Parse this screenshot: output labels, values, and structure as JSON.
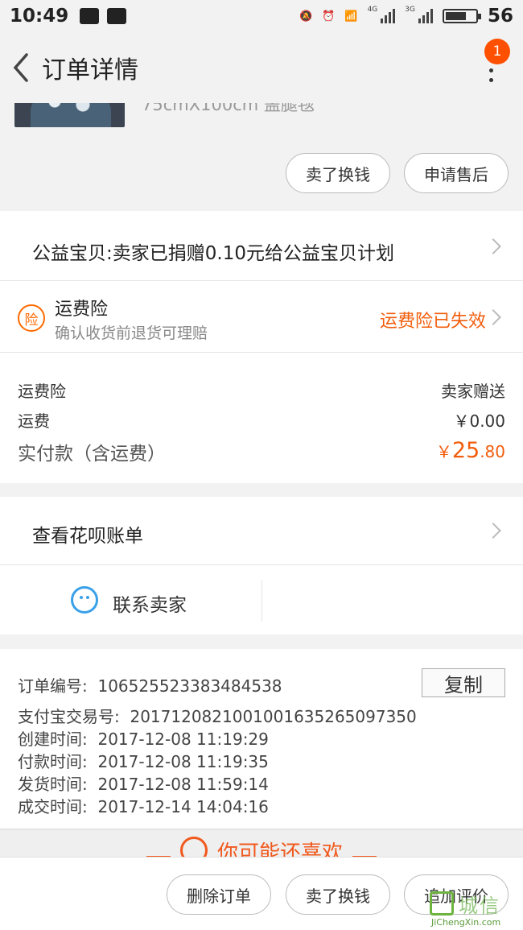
{
  "status_bar": {
    "time": "10:49",
    "network_1": "4G",
    "network_2": "3G",
    "battery": "56"
  },
  "header": {
    "title": "订单详情",
    "badge_count": "1"
  },
  "product": {
    "name_partial": "75cmX100cm 盖腿毯",
    "actions": [
      "卖了换钱",
      "申请售后"
    ]
  },
  "charity": {
    "text": "公益宝贝:卖家已捐赠0.10元给公益宝贝计划"
  },
  "shipping_insurance": {
    "icon_char": "险",
    "title": "运费险",
    "subtitle": "确认收货前退货可理赔",
    "status": "运费险已失效",
    "status_color": "#f25d0c"
  },
  "fees": {
    "rows": [
      {
        "label": "运费险",
        "value": "卖家赠送"
      },
      {
        "label": "运费",
        "value": "￥0.00"
      }
    ],
    "total_label": "实付款（含运费）",
    "total_currency": "￥",
    "total_integer": "25",
    "total_cents": ".80"
  },
  "huabei": {
    "label": "查看花呗账单"
  },
  "contact": {
    "label": "联系卖家",
    "icon_color": "#3aa1e8"
  },
  "order_info": {
    "copy_label": "复制",
    "rows": [
      {
        "label": "订单编号:",
        "value": "106525523383484538"
      },
      {
        "label": "支付宝交易号:",
        "value": "2017120821001001635265097350"
      },
      {
        "label": "创建时间:",
        "value": "2017-12-08 11:19:29"
      },
      {
        "label": "付款时间:",
        "value": "2017-12-08 11:19:35"
      },
      {
        "label": "发货时间:",
        "value": "2017-12-08 11:59:14"
      },
      {
        "label": "成交时间:",
        "value": "2017-12-14 14:04:16"
      }
    ]
  },
  "recommend": {
    "title": "你可能还喜欢"
  },
  "bottom_actions": [
    "删除订单",
    "卖了换钱",
    "追加评价"
  ],
  "watermark": {
    "cn": "城信",
    "en": "JiChengXin.com"
  },
  "accent_color": "#ff5000"
}
